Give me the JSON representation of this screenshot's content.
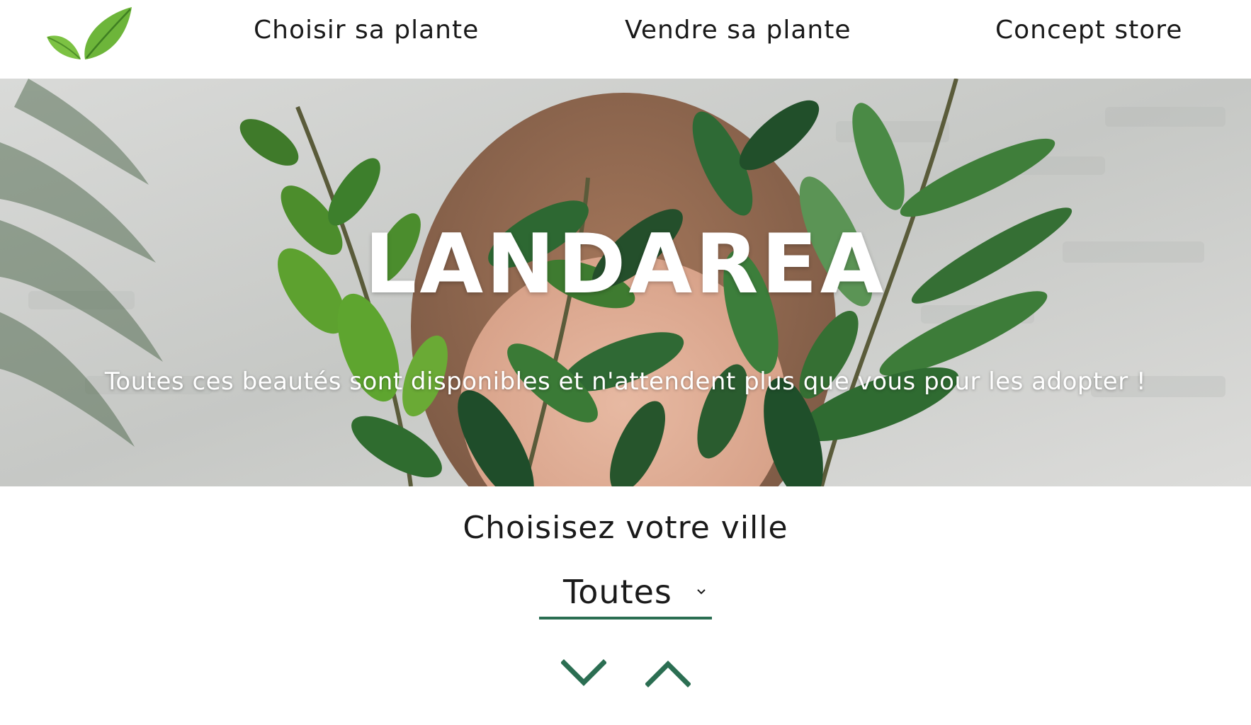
{
  "header": {
    "logo_icon": "leaf-icon",
    "nav": [
      {
        "label": "Choisir sa plante"
      },
      {
        "label": "Vendre sa plante"
      },
      {
        "label": "Concept store"
      }
    ]
  },
  "hero": {
    "title": "LANDAREA",
    "subtitle": "Toutes ces beautés sont disponibles et n'attendent plus que vous pour les adopter !"
  },
  "city_filter": {
    "heading": "Choisisez votre ville",
    "selected": "Toutes",
    "caret_icon": "chevron-down-icon"
  },
  "sort_controls": {
    "down_icon": "chevron-down-icon",
    "up_icon": "chevron-up-icon"
  },
  "colors": {
    "accent": "#2b6e52",
    "leaf_light": "#7cc243",
    "leaf_dark": "#3b7a2a"
  }
}
